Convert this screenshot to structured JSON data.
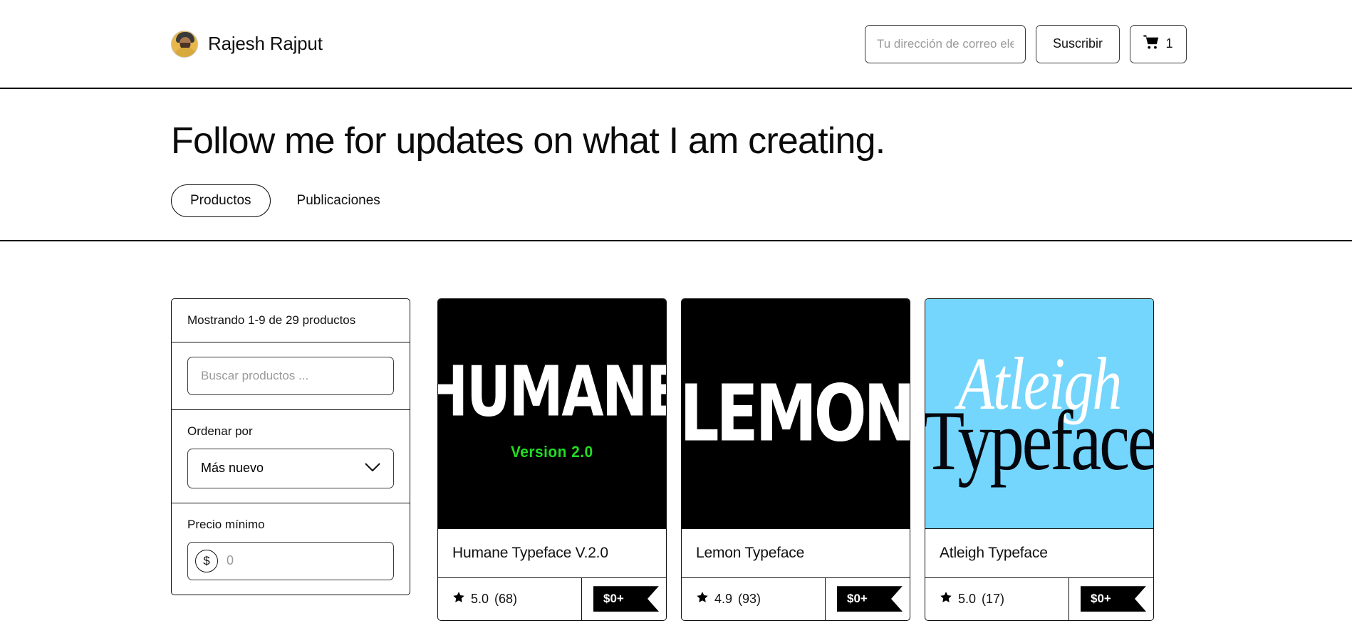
{
  "header": {
    "brand_name": "Rajesh Rajput",
    "avatar_name": "avatar",
    "email_placeholder": "Tu dirección de correo electrónico",
    "subscribe_label": "Suscribir",
    "cart_count": "1"
  },
  "hero": {
    "title": "Follow me for updates on what I am creating.",
    "tabs": [
      {
        "label": "Productos",
        "active": true
      },
      {
        "label": "Publicaciones",
        "active": false
      }
    ]
  },
  "filters": {
    "results_text": "Mostrando 1-9 de 29 productos",
    "search_placeholder": "Buscar productos ...",
    "search_value": "",
    "sort_label": "Ordenar por",
    "sort_value": "Más nuevo",
    "price_label": "Precio mínimo",
    "price_currency": "$",
    "price_placeholder": "0",
    "price_value": ""
  },
  "products": [
    {
      "title": "Humane Typeface V.2.0",
      "rating": "5.0",
      "reviews": "(68)",
      "price": "$0+",
      "art_primary": "HUMANE",
      "art_secondary": "Version 2.0",
      "bg": "#000000",
      "accent": "#22DD22"
    },
    {
      "title": "Lemon Typeface",
      "rating": "4.9",
      "reviews": "(93)",
      "price": "$0+",
      "art_primary": "LEMON",
      "art_secondary": "",
      "bg": "#000000",
      "accent": "#ffffff"
    },
    {
      "title": "Atleigh Typeface",
      "rating": "5.0",
      "reviews": "(17)",
      "price": "$0+",
      "art_primary": "Atleigh",
      "art_secondary": "Typeface",
      "bg": "#74D5FD",
      "accent": "#05070d"
    }
  ],
  "colors": {
    "border": "#111111",
    "muted": "#9a9a9a",
    "card_blue": "#74D5FD",
    "green": "#22DD22"
  }
}
